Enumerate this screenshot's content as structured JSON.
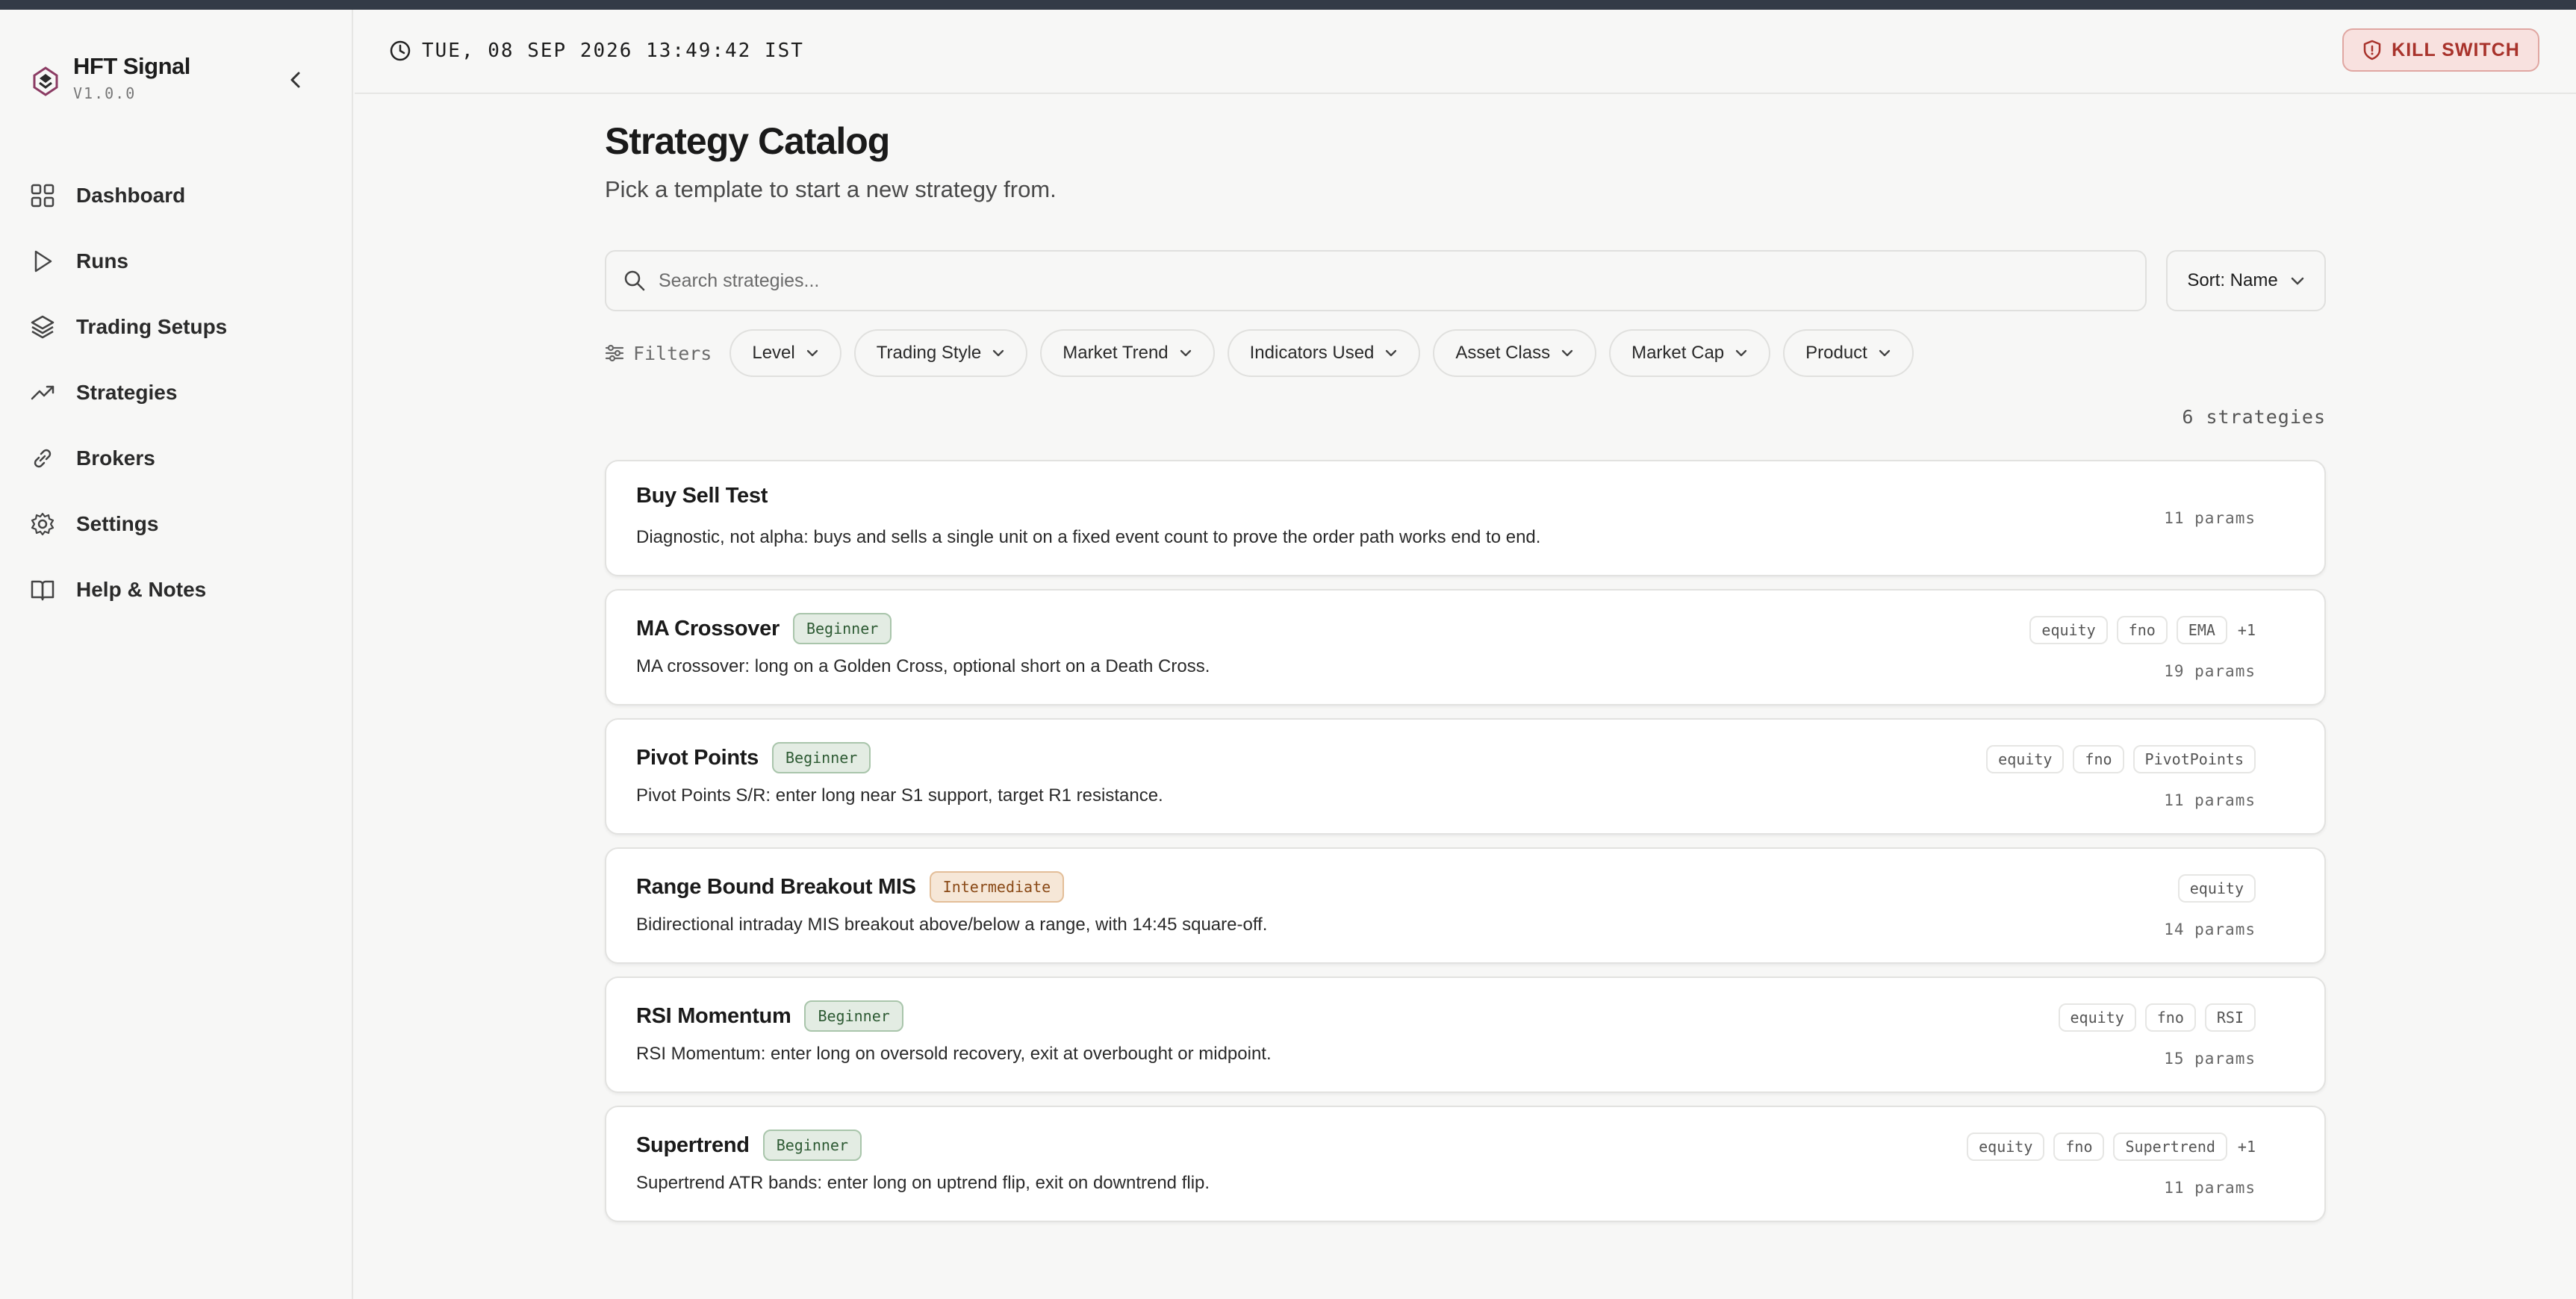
{
  "app": {
    "name": "HFT Signal",
    "version": "V1.0.0"
  },
  "sidebar": {
    "items": [
      {
        "label": "Dashboard",
        "icon": "grid-icon"
      },
      {
        "label": "Runs",
        "icon": "play-icon"
      },
      {
        "label": "Trading Setups",
        "icon": "layers-icon"
      },
      {
        "label": "Strategies",
        "icon": "trending-up-icon"
      },
      {
        "label": "Brokers",
        "icon": "link-icon"
      },
      {
        "label": "Settings",
        "icon": "gear-icon"
      },
      {
        "label": "Help & Notes",
        "icon": "book-icon"
      }
    ]
  },
  "header": {
    "clock": "TUE, 08 SEP 2026 13:49:42 IST",
    "kill_switch_label": "KILL SWITCH"
  },
  "page": {
    "title": "Strategy Catalog",
    "subtitle": "Pick a template to start a new strategy from."
  },
  "search": {
    "placeholder": "Search strategies...",
    "value": ""
  },
  "sort": {
    "label": "Sort: Name"
  },
  "filters": {
    "label": "Filters",
    "chips": [
      "Level",
      "Trading Style",
      "Market Trend",
      "Indicators Used",
      "Asset Class",
      "Market Cap",
      "Product"
    ]
  },
  "count_label": "6 strategies",
  "strategies": [
    {
      "name": "Buy Sell Test",
      "level": "",
      "description": "Diagnostic, not alpha: buys and sells a single unit on a fixed event count to prove the order path works end to end.",
      "tags": [],
      "more": "",
      "params": "11 params"
    },
    {
      "name": "MA Crossover",
      "level": "Beginner",
      "description": "MA crossover: long on a Golden Cross, optional short on a Death Cross.",
      "tags": [
        "equity",
        "fno",
        "EMA"
      ],
      "more": "+1",
      "params": "19 params"
    },
    {
      "name": "Pivot Points",
      "level": "Beginner",
      "description": "Pivot Points S/R: enter long near S1 support, target R1 resistance.",
      "tags": [
        "equity",
        "fno",
        "PivotPoints"
      ],
      "more": "",
      "params": "11 params"
    },
    {
      "name": "Range Bound Breakout MIS",
      "level": "Intermediate",
      "description": "Bidirectional intraday MIS breakout above/below a range, with 14:45 square-off.",
      "tags": [
        "equity"
      ],
      "more": "",
      "params": "14 params"
    },
    {
      "name": "RSI Momentum",
      "level": "Beginner",
      "description": "RSI Momentum: enter long on oversold recovery, exit at overbought or midpoint.",
      "tags": [
        "equity",
        "fno",
        "RSI"
      ],
      "more": "",
      "params": "15 params"
    },
    {
      "name": "Supertrend",
      "level": "Beginner",
      "description": "Supertrend ATR bands: enter long on uptrend flip, exit on downtrend flip.",
      "tags": [
        "equity",
        "fno",
        "Supertrend"
      ],
      "more": "+1",
      "params": "11 params"
    }
  ],
  "colors": {
    "accent_danger": "#a8322b",
    "beginner": "#2d5a33",
    "intermediate": "#8a4a17",
    "topbar": "#333b47"
  }
}
